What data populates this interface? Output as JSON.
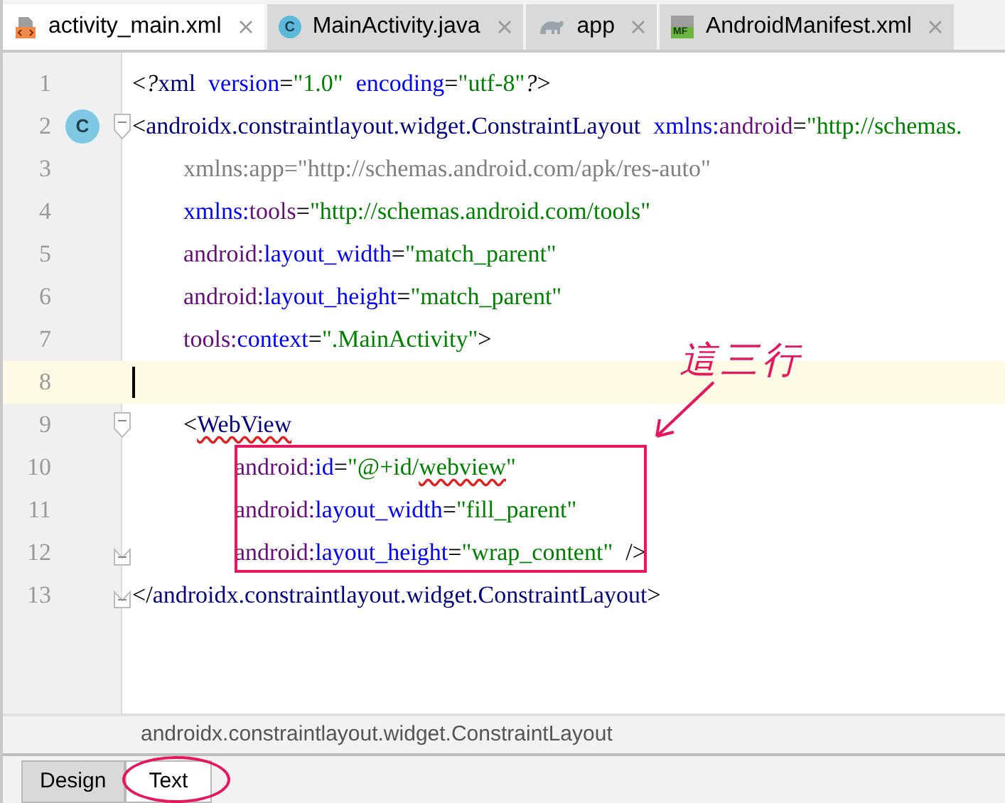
{
  "tabs": [
    {
      "label": "activity_main.xml",
      "kind": "layout",
      "selected": true
    },
    {
      "label": "MainActivity.java",
      "kind": "class",
      "icon_text": "C",
      "selected": false
    },
    {
      "label": "app",
      "kind": "gradle",
      "selected": false
    },
    {
      "label": "AndroidManifest.xml",
      "kind": "manifest",
      "icon_text": "MF",
      "selected": false
    }
  ],
  "lines": [
    {
      "number": "1",
      "tokens": [
        {
          "kind": "plain",
          "text": "<"
        },
        {
          "kind": "pi",
          "text": "?"
        },
        {
          "kind": "tag",
          "text": "xml"
        },
        {
          "kind": "attr",
          "text": "version",
          "spaced": true
        },
        {
          "kind": "plain",
          "text": "="
        },
        {
          "kind": "str",
          "text": "\"1.0\""
        },
        {
          "kind": "attr",
          "text": "encoding",
          "spaced": true
        },
        {
          "kind": "plain",
          "text": "="
        },
        {
          "kind": "str",
          "text": "\"utf-8\""
        },
        {
          "kind": "pi",
          "text": "?"
        },
        {
          "kind": "plain",
          "text": ">"
        }
      ]
    },
    {
      "number": "2",
      "badge": "C",
      "fold_start": true,
      "tokens": [
        {
          "kind": "plain",
          "text": "<"
        },
        {
          "kind": "tag",
          "text": "androidx.constraintlayout.widget.ConstraintLayout"
        },
        {
          "kind": "attr",
          "text": "xmlns:",
          "spaced": true
        },
        {
          "kind": "ns",
          "text": "android"
        },
        {
          "kind": "plain",
          "text": "="
        },
        {
          "kind": "str",
          "text": "\"http://schemas."
        }
      ],
      "children": [
        {
          "number": "3",
          "tokens": [
            {
              "kind": "dim",
              "text": "xmlns:app=\"http://schemas.android.com/apk/res-auto\""
            }
          ]
        },
        {
          "number": "4",
          "tokens": [
            {
              "kind": "attr",
              "text": "xmlns:"
            },
            {
              "kind": "ns",
              "text": "tools"
            },
            {
              "kind": "plain",
              "text": "="
            },
            {
              "kind": "str",
              "text": "\"http://schemas.android.com/tools\""
            }
          ]
        },
        {
          "number": "5",
          "tokens": [
            {
              "kind": "ns",
              "text": "android:"
            },
            {
              "kind": "attr",
              "text": "layout_width"
            },
            {
              "kind": "plain",
              "text": "="
            },
            {
              "kind": "str",
              "text": "\"match_parent\""
            }
          ]
        },
        {
          "number": "6",
          "tokens": [
            {
              "kind": "ns",
              "text": "android:"
            },
            {
              "kind": "attr",
              "text": "layout_height"
            },
            {
              "kind": "plain",
              "text": "="
            },
            {
              "kind": "str",
              "text": "\"match_parent\""
            }
          ]
        },
        {
          "number": "7",
          "tokens": [
            {
              "kind": "ns",
              "text": "tools:"
            },
            {
              "kind": "attr",
              "text": "context"
            },
            {
              "kind": "plain",
              "text": "="
            },
            {
              "kind": "str",
              "text": "\".MainActivity\""
            },
            {
              "kind": "plain",
              "text": ">"
            }
          ]
        },
        {
          "number": "8",
          "current": true
        },
        {
          "number": "9",
          "fold_start": true,
          "tokens": [
            {
              "kind": "plain",
              "text": "<"
            },
            {
              "kind": "tag",
              "text": "WebView",
              "typo": true
            }
          ],
          "children": [
            {
              "number": "10",
              "tokens": [
                {
                  "kind": "ns",
                  "text": "android:"
                },
                {
                  "kind": "attr",
                  "text": "id"
                },
                {
                  "kind": "plain",
                  "text": "="
                },
                {
                  "kind": "str",
                  "text": "\"@+id/"
                },
                {
                  "kind": "str",
                  "text": "webview",
                  "typo": true
                },
                {
                  "kind": "str",
                  "text": "\""
                }
              ]
            },
            {
              "number": "11",
              "tokens": [
                {
                  "kind": "ns",
                  "text": "android:"
                },
                {
                  "kind": "attr",
                  "text": "layout_width"
                },
                {
                  "kind": "plain",
                  "text": "="
                },
                {
                  "kind": "str",
                  "text": "\"fill_parent\""
                }
              ]
            },
            {
              "number": "12",
              "fold_end": true,
              "tokens": [
                {
                  "kind": "ns",
                  "text": "android:"
                },
                {
                  "kind": "attr",
                  "text": "layout_height"
                },
                {
                  "kind": "plain",
                  "text": "="
                },
                {
                  "kind": "str",
                  "text": "\"wrap_content\""
                },
                {
                  "kind": "plain",
                  "text": "/>",
                  "spaced": true
                }
              ]
            }
          ]
        }
      ]
    },
    {
      "number": "13",
      "fold_end": true,
      "tokens": [
        {
          "kind": "plain",
          "text": "</"
        },
        {
          "kind": "tag",
          "text": "androidx.constraintlayout.widget.ConstraintLayout"
        },
        {
          "kind": "plain",
          "text": ">"
        }
      ]
    }
  ],
  "breadcrumb": "androidx.constraintlayout.widget.ConstraintLayout",
  "bottom_tabs": [
    {
      "label": "Design",
      "selected": false
    },
    {
      "label": "Text",
      "selected": true
    }
  ],
  "annotation": {
    "text": "這三行"
  }
}
